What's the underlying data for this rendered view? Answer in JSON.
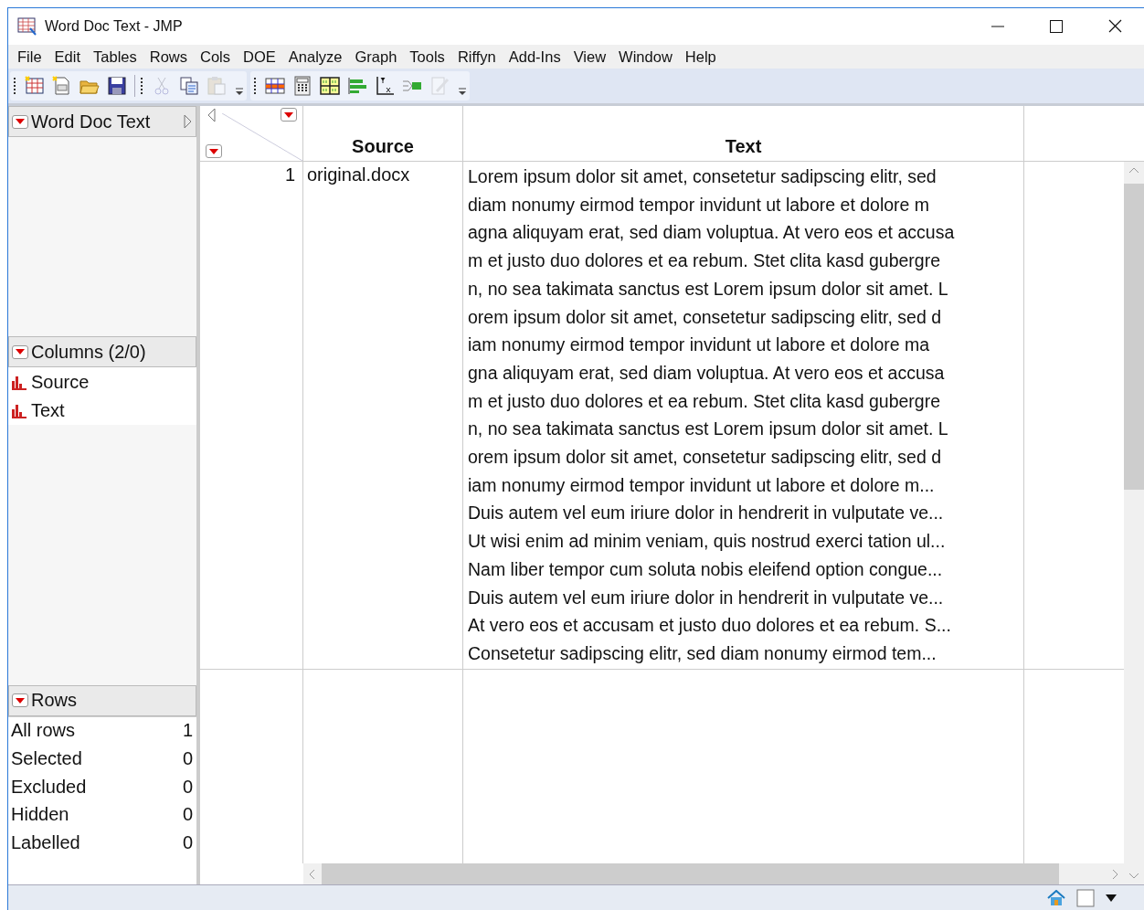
{
  "window": {
    "title": "Word Doc Text - JMP"
  },
  "menu": [
    "File",
    "Edit",
    "Tables",
    "Rows",
    "Cols",
    "DOE",
    "Analyze",
    "Graph",
    "Tools",
    "Riffyn",
    "Add-Ins",
    "View",
    "Window",
    "Help"
  ],
  "toolbars": [
    {
      "groups": [
        [
          {
            "kind": "new-table",
            "disabled": false
          },
          {
            "kind": "new-script",
            "disabled": false
          },
          {
            "kind": "open",
            "disabled": false
          },
          {
            "kind": "save",
            "disabled": false
          }
        ],
        [
          {
            "kind": "cut",
            "disabled": true
          },
          {
            "kind": "copy",
            "disabled": false
          },
          {
            "kind": "paste",
            "disabled": true
          }
        ]
      ]
    },
    {
      "groups": [
        [
          {
            "kind": "data-table",
            "disabled": false
          },
          {
            "kind": "calculator",
            "disabled": false
          },
          {
            "kind": "grid",
            "disabled": false
          },
          {
            "kind": "bar-chart",
            "disabled": false
          },
          {
            "kind": "axis",
            "disabled": false
          },
          {
            "kind": "arrow",
            "disabled": false
          },
          {
            "kind": "pencil",
            "disabled": true
          }
        ]
      ]
    }
  ],
  "table_panel": {
    "title": "Word Doc Text"
  },
  "columns_panel": {
    "title": "Columns (2/0)",
    "columns": [
      "Source",
      "Text"
    ]
  },
  "rows_panel": {
    "title": "Rows",
    "rows": [
      {
        "label": "All rows",
        "count": "1"
      },
      {
        "label": "Selected",
        "count": "0"
      },
      {
        "label": "Excluded",
        "count": "0"
      },
      {
        "label": "Hidden",
        "count": "0"
      },
      {
        "label": "Labelled",
        "count": "0"
      }
    ]
  },
  "table": {
    "columns": [
      "Source",
      "Text"
    ],
    "rows": [
      {
        "row_number": "1",
        "source": "original.docx",
        "text_lines": [
          "Lorem ipsum dolor sit amet, consetetur sadipscing elitr,  sed",
          "diam nonumy eirmod tempor invidunt ut labore et dolore m",
          "agna aliquyam erat, sed diam voluptua. At vero eos et accusa",
          "m et justo duo dolores et ea rebum. Stet clita kasd gubergre",
          "n, no sea takimata sanctus est Lorem ipsum dolor sit amet. L",
          "orem ipsum dolor sit amet, consetetur sadipscing elitr,  sed d",
          "iam nonumy eirmod tempor invidunt ut labore et dolore ma",
          "gna aliquyam erat, sed diam voluptua. At vero eos et accusa",
          "m et justo duo dolores et ea rebum. Stet clita kasd gubergre",
          "n, no sea takimata sanctus est Lorem ipsum dolor sit amet. L",
          "orem ipsum dolor sit amet, consetetur sadipscing elitr,  sed d",
          "iam nonumy eirmod tempor invidunt ut labore et dolore m...",
          "Duis autem vel eum iriure dolor in hendrerit in vulputate ve...",
          "Ut wisi enim ad minim veniam, quis nostrud exerci tation ul...",
          "Nam liber tempor cum soluta nobis eleifend option congue...",
          "Duis autem vel eum iriure dolor in hendrerit in vulputate ve...",
          "At vero eos et accusam et justo duo dolores et ea rebum. S...",
          "Consetetur sadipscing elitr,  sed diam nonumy eirmod tem..."
        ]
      }
    ]
  }
}
